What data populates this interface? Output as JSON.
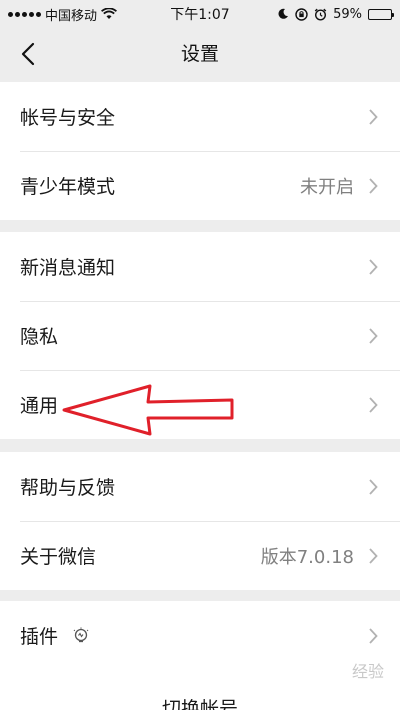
{
  "status_bar": {
    "carrier": "中国移动",
    "time": "下午1:07",
    "battery_percent": "59%",
    "battery_level": 0.59
  },
  "nav": {
    "title": "设置"
  },
  "settings": {
    "group1": [
      {
        "label": "帐号与安全",
        "value": ""
      },
      {
        "label": "青少年模式",
        "value": "未开启"
      }
    ],
    "group2": [
      {
        "label": "新消息通知",
        "value": ""
      },
      {
        "label": "隐私",
        "value": ""
      },
      {
        "label": "通用",
        "value": ""
      }
    ],
    "group3": [
      {
        "label": "帮助与反馈",
        "value": ""
      },
      {
        "label": "关于微信",
        "value": "版本7.0.18"
      }
    ],
    "group4": [
      {
        "label": "插件",
        "value": ""
      }
    ]
  },
  "bottom": {
    "partial_label": "切换帐号"
  },
  "annotation": {
    "color": "#e0202a"
  },
  "watermark": {
    "text": "经验"
  },
  "icons": {
    "back": "back-chevron-icon",
    "chevron": "chevron-right-icon",
    "plugin": "plugin-bulb-icon"
  }
}
